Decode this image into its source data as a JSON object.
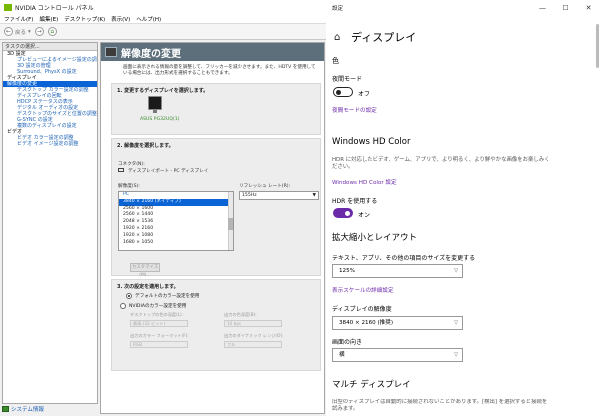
{
  "nvidia": {
    "title": "NVIDIA コントロール パネル",
    "menu": [
      "ファイル(F)",
      "編集(E)",
      "デスクトップ(K)",
      "表示(V)",
      "ヘルプ(H)"
    ],
    "toolbar": {
      "back": "戻る"
    },
    "tree_header": "タスクの選択...",
    "tree": [
      {
        "label": "3D 設定",
        "type": "cat"
      },
      {
        "label": "プレビューによるイメージ設定の調整",
        "type": "sub"
      },
      {
        "label": "3D 設定の管理",
        "type": "sub"
      },
      {
        "label": "Surround、PhysX の設定",
        "type": "sub"
      },
      {
        "label": "ディスプレイ",
        "type": "cat"
      },
      {
        "label": "解像度の変更",
        "type": "sel"
      },
      {
        "label": "デスクトップ カラー設定の調整",
        "type": "sub"
      },
      {
        "label": "ディスプレイの回転",
        "type": "sub"
      },
      {
        "label": "HDCP ステータスの表示",
        "type": "sub"
      },
      {
        "label": "デジタル オーディオの設定",
        "type": "sub"
      },
      {
        "label": "デスクトップのサイズと位置の調整",
        "type": "sub"
      },
      {
        "label": "G-SYNC の設定",
        "type": "sub"
      },
      {
        "label": "複数のディスプレイの設定",
        "type": "sub"
      },
      {
        "label": "ビデオ",
        "type": "cat"
      },
      {
        "label": "ビデオ カラー設定の調整",
        "type": "sub"
      },
      {
        "label": "ビデオ イメージ設定の調整",
        "type": "sub"
      }
    ],
    "footer": "システム情報",
    "page_title": "解像度の変更",
    "description": "画面に表示される情報の量を調整して、フリッカーを減少させます。また、HDTV を使用している場合には、出力形式を選択することもできます。",
    "step1": "1. 変更するディスプレイを選択します。",
    "monitor_label": "ASUS PG32UQ(1)",
    "step2": "2. 解像度を選択します。",
    "connector_label": "コネクタ(N):",
    "connector_value": "ディスプレイポート - PC ディスプレイ",
    "resolution_label": "解像度(S):",
    "refresh_label": "リフレッシュ レート(R):",
    "refresh_value": "155Hz",
    "resolutions": [
      {
        "label": "PC",
        "type": "grp"
      },
      {
        "label": "3840 × 2160 (ネイティブ)",
        "type": "sel"
      },
      {
        "label": "2560 × 1600",
        "type": "item"
      },
      {
        "label": "2560 × 1440",
        "type": "item"
      },
      {
        "label": "2048 × 1536",
        "type": "item"
      },
      {
        "label": "1920 × 2160",
        "type": "item"
      },
      {
        "label": "1920 × 1080",
        "type": "item"
      },
      {
        "label": "1680 × 1050",
        "type": "item"
      }
    ],
    "customize_button": "カスタマイズ(M)...",
    "step3": "3. 次の設定を適用します。",
    "radio_default": "デフォルトのカラー設定を使用",
    "radio_nvidia": "NVIDIAのカラー設定を使用",
    "depth_label": "デスクトップの色の深度(L):",
    "depth_value": "最高 (32 ビット)",
    "bpc_label": "出力の色深度(B):",
    "bpc_value": "10 bpc",
    "format_label": "出力のカラー フォーマット(F):",
    "format_value": "RGB",
    "range_label": "出力のダイナミック レンジ(O):",
    "range_value": "フル"
  },
  "settings": {
    "window_title": "設定",
    "window_buttons": [
      "—",
      "☐",
      "✕"
    ],
    "page_title": "ディスプレイ",
    "color_section": "色",
    "night_mode_label": "夜間モード",
    "night_mode_state": "オフ",
    "night_mode_link": "夜間モードの設定",
    "hd_color_section": "Windows HD Color",
    "hd_color_desc": "HDR に対応したビデオ、ゲーム、アプリで、より明るく、より鮮やかな画像をお楽しみください。",
    "hd_color_link": "Windows HD Color 設定",
    "hdr_label": "HDR を使用する",
    "hdr_state": "オン",
    "scale_section": "拡大縮小とレイアウト",
    "scale_label": "テキスト、アプリ、その他の項目のサイズを変更する",
    "scale_value": "125%",
    "scale_link": "表示スケールの詳細設定",
    "resolution_label": "ディスプレイの解像度",
    "resolution_value": "3840 × 2160 (推奨)",
    "orientation_label": "画面の向き",
    "orientation_value": "横",
    "multi_section": "マルチ ディスプレイ",
    "multi_desc": "旧型のディスプレイは自動的に接続されないことがあります。[検出] を選択すると接続を試みます。"
  }
}
